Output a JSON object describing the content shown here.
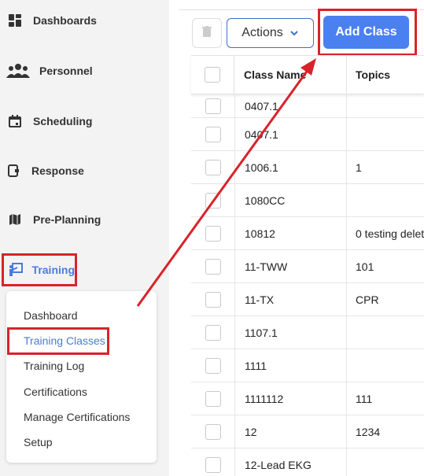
{
  "sidebar": {
    "items": [
      {
        "label": "Dashboards",
        "icon": "dashboard-grid-icon"
      },
      {
        "label": "Personnel",
        "icon": "people-icon"
      },
      {
        "label": "Scheduling",
        "icon": "calendar-icon"
      },
      {
        "label": "Response",
        "icon": "response-icon"
      },
      {
        "label": "Pre-Planning",
        "icon": "map-icon"
      },
      {
        "label": "Training",
        "icon": "training-icon"
      }
    ],
    "training_submenu": [
      {
        "label": "Dashboard"
      },
      {
        "label": "Training Classes"
      },
      {
        "label": "Training Log"
      },
      {
        "label": "Certifications"
      },
      {
        "label": "Manage Certifications"
      },
      {
        "label": "Setup"
      }
    ]
  },
  "toolbar": {
    "actions_label": "Actions",
    "add_class_label": "Add Class"
  },
  "table": {
    "headers": {
      "name": "Class Name",
      "topics": "Topics"
    },
    "rows": [
      {
        "name": "0407.1",
        "topics": ""
      },
      {
        "name": "0407.1",
        "topics": ""
      },
      {
        "name": "1006.1",
        "topics": "1"
      },
      {
        "name": "1080CC",
        "topics": ""
      },
      {
        "name": "10812",
        "topics": "0 testing delet"
      },
      {
        "name": "11-TWW",
        "topics": "101"
      },
      {
        "name": "11-TX",
        "topics": "CPR"
      },
      {
        "name": "1107.1",
        "topics": ""
      },
      {
        "name": "1111",
        "topics": ""
      },
      {
        "name": "1111112",
        "topics": "111"
      },
      {
        "name": "12",
        "topics": "1234"
      },
      {
        "name": "12-Lead EKG",
        "topics": ""
      }
    ]
  },
  "colors": {
    "accent": "#4a80f0",
    "annotation_red": "#d8232a",
    "active_text": "#4a7bd8"
  }
}
